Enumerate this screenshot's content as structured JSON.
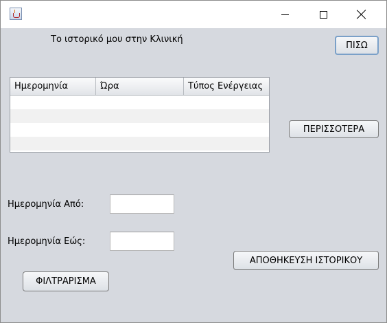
{
  "header": {
    "title": "Το ιστορικό μου στην Κλινική"
  },
  "buttons": {
    "back": "ΠΙΣΩ",
    "more": "ΠΕΡΙΣΣΟΤΕΡΑ",
    "save_history": "ΑΠΟΘΗΚΕΥΣΗ ΙΣΤΟΡΙΚΟΥ",
    "filter": "ΦΙΛΤΡΑΡΙΣΜΑ"
  },
  "table": {
    "columns": [
      "Ημερομηνία",
      "Ώρα",
      "Τύπος Ενέργειας"
    ],
    "rows": []
  },
  "filters": {
    "date_from_label": "Ημερομηνία Από:",
    "date_from_value": "",
    "date_to_label": "Ημερομηνία Εώς:",
    "date_to_value": ""
  },
  "icons": {
    "app": "java-cup-icon",
    "minimize": "minimize-icon",
    "maximize": "maximize-icon",
    "close": "close-icon"
  }
}
